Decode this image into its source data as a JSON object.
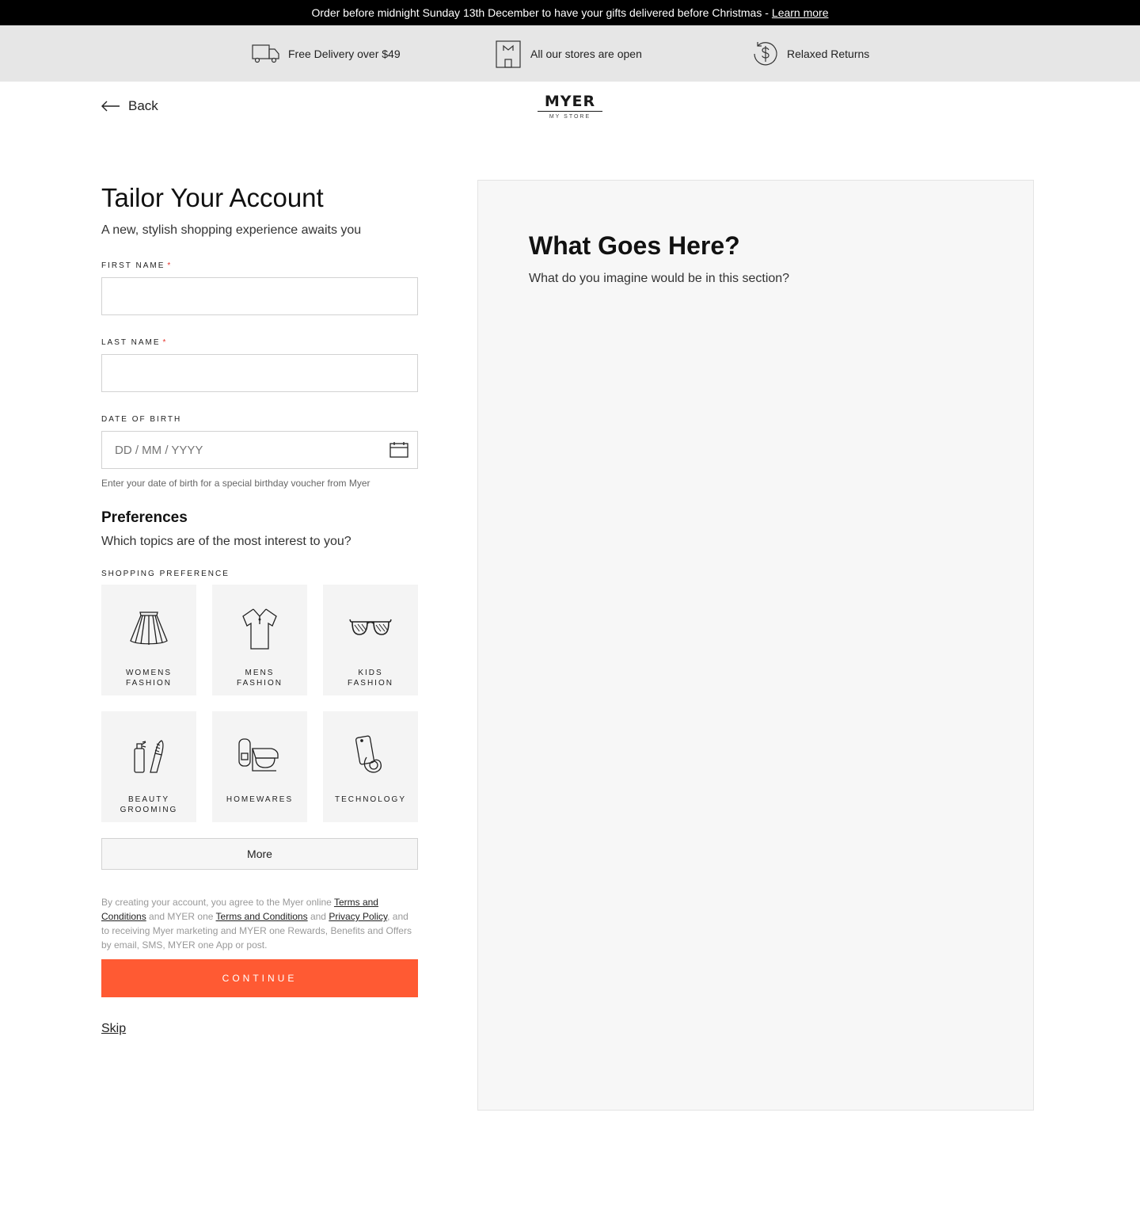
{
  "promo": {
    "text": "Order before midnight Sunday 13th December to have your gifts delivered before Christmas -",
    "link": "Learn more"
  },
  "usps": [
    {
      "label": "Free Delivery over $49",
      "icon": "delivery-truck-icon"
    },
    {
      "label": "All our stores are open",
      "icon": "store-icon"
    },
    {
      "label": "Relaxed Returns",
      "icon": "returns-dollar-icon"
    }
  ],
  "nav": {
    "back_label": "Back"
  },
  "logo": {
    "main": "MYER",
    "sub": "MY STORE"
  },
  "form": {
    "title": "Tailor Your Account",
    "subtitle": "A new, stylish shopping experience awaits you",
    "first_name_label": "FIRST NAME",
    "first_name_value": "",
    "last_name_label": "LAST NAME",
    "last_name_value": "",
    "required_mark": "*",
    "dob_label": "DATE OF BIRTH",
    "dob_placeholder": "DD / MM / YYYY",
    "dob_helper": "Enter your date of birth for a special birthday voucher from Myer"
  },
  "preferences": {
    "title": "Preferences",
    "subtitle": "Which topics are of the most interest to you?",
    "group_label": "SHOPPING PREFERENCE",
    "tiles": [
      {
        "line1": "WOMENS",
        "line2": "FASHION",
        "icon": "skirt-icon"
      },
      {
        "line1": "MENS",
        "line2": "FASHION",
        "icon": "polo-shirt-icon"
      },
      {
        "line1": "KIDS",
        "line2": "FASHION",
        "icon": "sunglasses-icon"
      },
      {
        "line1": "BEAUTY",
        "line2": "GROOMING",
        "icon": "spray-comb-icon"
      },
      {
        "line1": "HOMEWARES",
        "line2": "",
        "icon": "kitchen-mixer-icon"
      },
      {
        "line1": "TECHNOLOGY",
        "line2": "",
        "icon": "phone-icon"
      }
    ],
    "more_label": "More"
  },
  "legal": {
    "part1": "By creating your account, you agree to the Myer online ",
    "link1": "Terms and Conditions",
    "part2": " and MYER one ",
    "link2": "Terms and Conditions",
    "part3": " and ",
    "link3": "Privacy Policy",
    "part4": ", and to receiving Myer marketing and MYER one Rewards, Benefits and Offers by email, SMS, MYER one App or post."
  },
  "actions": {
    "continue_label": "CONTINUE",
    "skip_label": "Skip"
  },
  "side_panel": {
    "title": "What Goes Here?",
    "subtitle": "What do you imagine would be in this section?"
  },
  "colors": {
    "accent": "#ff5a33",
    "promo_bg": "#000000",
    "usp_bg": "#e6e6e6",
    "panel_bg": "#f7f7f7",
    "required": "#e5332a"
  }
}
